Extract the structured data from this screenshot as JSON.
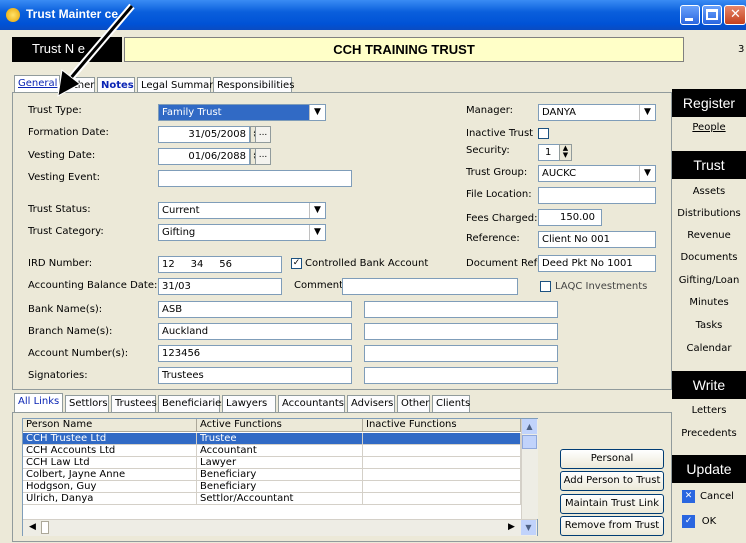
{
  "window": {
    "title": "Trust Mainter ce"
  },
  "header": {
    "name_label": "Trust N   e",
    "trust_name": "CCH TRAINING TRUST",
    "corner": "3"
  },
  "tabs": [
    {
      "label": "General"
    },
    {
      "label": "Other"
    },
    {
      "label": "Notes"
    },
    {
      "label": "Legal Summary"
    },
    {
      "label": "Responsibilities"
    }
  ],
  "general": {
    "trust_type": {
      "label": "Trust Type:",
      "value": "Family Trust"
    },
    "formation_date": {
      "label": "Formation Date:",
      "value": "31/05/2008"
    },
    "vesting_date": {
      "label": "Vesting Date:",
      "value": "01/06/2088"
    },
    "vesting_event": {
      "label": "Vesting Event:",
      "value": ""
    },
    "trust_status": {
      "label": "Trust Status:",
      "value": "Current"
    },
    "trust_category": {
      "label": "Trust Category:",
      "value": "Gifting"
    },
    "ird_number": {
      "label": "IRD Number:",
      "value": "12     34     56"
    },
    "controlled_bank": {
      "label": "Controlled Bank Account",
      "checked": true
    },
    "accounting_balance_date": {
      "label": "Accounting Balance Date:",
      "value": "31/03"
    },
    "comment": {
      "label": "Comment:",
      "value": ""
    },
    "bank_names": {
      "label": "Bank Name(s):",
      "value": "ASB"
    },
    "branch_names": {
      "label": "Branch Name(s):",
      "value": "Auckland"
    },
    "account_numbers": {
      "label": "Account Number(s):",
      "value": "123456"
    },
    "signatories": {
      "label": "Signatories:",
      "value": "Trustees"
    },
    "manager": {
      "label": "Manager:",
      "value": "DANYA"
    },
    "inactive_trust": {
      "label": "Inactive Trust",
      "checked": false
    },
    "security": {
      "label": "Security:",
      "value": "1"
    },
    "trust_group": {
      "label": "Trust Group:",
      "value": "AUCKC"
    },
    "file_location": {
      "label": "File Location:",
      "value": ""
    },
    "fees_charged": {
      "label": "Fees Charged:",
      "value": "150.00"
    },
    "reference": {
      "label": "Reference:",
      "value": "Client No 001"
    },
    "document_ref": {
      "label": "Document Ref:",
      "value": "Deed Pkt No 1001"
    },
    "laqc": {
      "label": "LAQC Investments",
      "checked": false
    }
  },
  "sidebar": {
    "register": "Register",
    "register_items": [
      "People"
    ],
    "trust": "Trust",
    "trust_items": [
      "Assets",
      "Distributions",
      "Revenue",
      "Documents",
      "Gifting/Loan",
      "Minutes",
      "Tasks",
      "Calendar"
    ],
    "write": "Write",
    "write_items": [
      "Letters",
      "Precedents"
    ],
    "update": "Update",
    "cancel": "Cancel",
    "ok": "OK"
  },
  "links_tabs": [
    "All Links",
    "Settlors",
    "Trustees",
    "Beneficiaries",
    "Lawyers",
    "Accountants",
    "Advisers",
    "Other",
    "Clients"
  ],
  "grid": {
    "columns": [
      "Person Name",
      "Active Functions",
      "Inactive Functions"
    ],
    "rows": [
      {
        "name": "CCH Trustee Ltd",
        "active": "Trustee",
        "inactive": ""
      },
      {
        "name": "CCH Accounts Ltd",
        "active": "Accountant",
        "inactive": ""
      },
      {
        "name": "CCH Law Ltd",
        "active": "Lawyer",
        "inactive": ""
      },
      {
        "name": "Colbert, Jayne Anne",
        "active": "Beneficiary",
        "inactive": ""
      },
      {
        "name": "Hodgson, Guy",
        "active": "Beneficiary",
        "inactive": ""
      },
      {
        "name": "Ulrich, Danya",
        "active": "Settlor/Accountant",
        "inactive": ""
      }
    ]
  },
  "actions": [
    "Personal Information",
    "Add Person to Trust",
    "Maintain Trust Link",
    "Remove from Trust"
  ]
}
